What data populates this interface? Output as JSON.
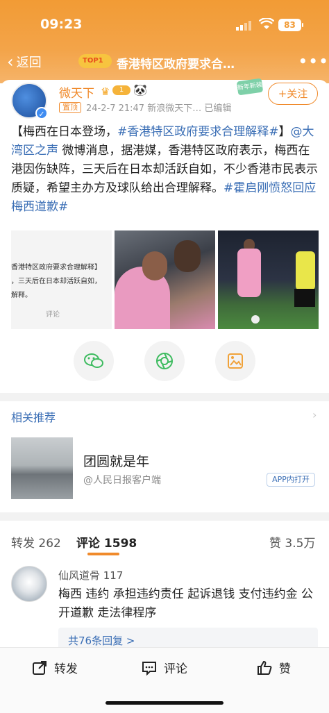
{
  "status_bar": {
    "time": "09:23",
    "battery": "83"
  },
  "navbar": {
    "back_label": "返回",
    "hot_badge": "TOP1",
    "title": "香港特区政府要求合…",
    "more": "•••"
  },
  "post": {
    "author": "微天下",
    "level": "1",
    "pinned_label": "置顶",
    "meta": "24-2-7 21:47  新浪微天下…  已编辑",
    "sticker": "新年新装",
    "follow_label": "+关注",
    "text_prefix": "【梅西在日本登场，",
    "tag1": "#香港特区政府要求合理解释#",
    "text_mid1": "】",
    "mention": "@大湾区之声",
    "text_mid2": " 微博消息，据港媒，香港特区政府表示，梅西在港因伤缺阵，三天后在日本却活跃自如，不少香港市民表示质疑，希望主办方及球队给出合理解释。",
    "tag2": "#霍启刚愤怒回应梅西道歉#",
    "image1_lines": [
      "香港特区政府要求合理解释】",
      "，三天后在日本却活跃自如，",
      "解释。"
    ],
    "image1_comment": "评论"
  },
  "related": {
    "header": "相关推荐",
    "title": "团圆就是年",
    "source": "@人民日报客户端",
    "app_open": "APP内打开"
  },
  "tabs": {
    "repost": "转发 262",
    "comment": "评论 1598",
    "like": "赞 3.5万"
  },
  "comment": {
    "user": "仙风道骨 117",
    "text": "梅西 违约  承担违约责任  起诉退钱  支付违约金  公开道歉  走法律程序",
    "replies": "共76条回复 >"
  },
  "bottom_bar": {
    "repost": "转发",
    "comment": "评论",
    "like": "赞"
  },
  "colors": {
    "accent": "#f08a2b",
    "link": "#3a6eb5",
    "header": "#f29b35"
  }
}
